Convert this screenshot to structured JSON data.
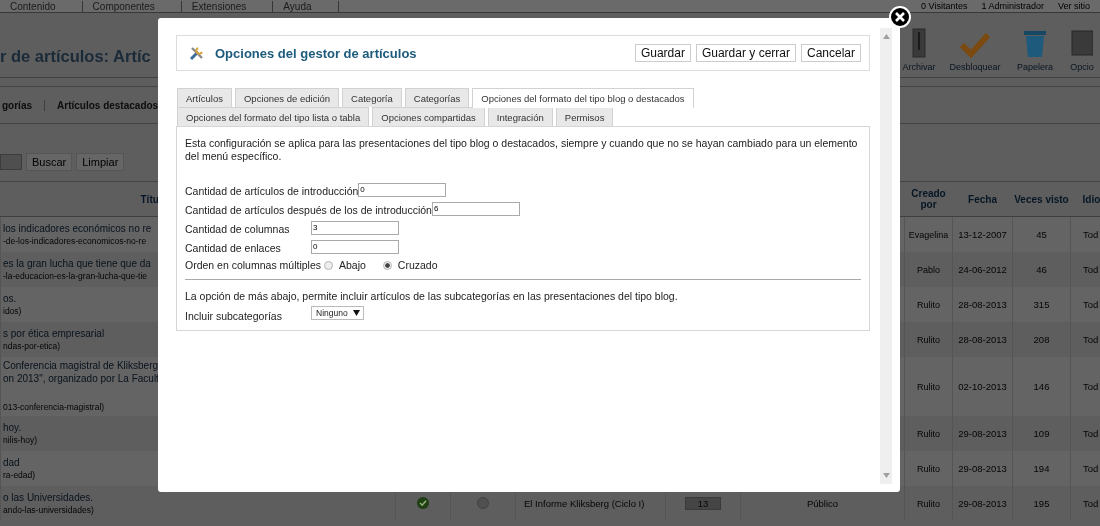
{
  "top_menu": {
    "items": [
      "Contenido",
      "Componentes",
      "Extensiones",
      "Ayuda"
    ],
    "right": [
      "0 Visitantes",
      "1 Administrador",
      "Ver sitio"
    ]
  },
  "page_title": "r de artículos: Artíc",
  "toolbar": [
    {
      "label": "Archivar",
      "kind": "archive"
    },
    {
      "label": "Desbloquear",
      "kind": "check"
    },
    {
      "label": "Papelera",
      "kind": "trash"
    },
    {
      "label": "Opcio",
      "kind": "options"
    }
  ],
  "subnav": [
    "gorías",
    "Artículos destacados"
  ],
  "filter_buttons": [
    "Buscar",
    "Limpiar"
  ],
  "table": {
    "columns": {
      "title": "Títu",
      "author": "Creado por",
      "date": "Fecha",
      "hits": "Veces visto",
      "language": "Idio"
    },
    "rows": [
      {
        "title": [
          "los indicadores económicos no re"
        ],
        "alias": "-de-los-indicadores-economicos-no-re",
        "author": "Evagelina",
        "date": "13-12-2007",
        "hits": "45",
        "language": "Tod"
      },
      {
        "title": [
          "es la gran lucha que tiene que da"
        ],
        "alias": "-la-educacion-es-la-gran-lucha-que-tie",
        "author": "Pablo",
        "date": "24-06-2012",
        "hits": "46",
        "language": "Tod"
      },
      {
        "title": [
          "os."
        ],
        "alias": "idos)",
        "author": "Rulito",
        "date": "28-08-2013",
        "hits": "315",
        "language": "Tod"
      },
      {
        "title": [
          "s por ética empresarial"
        ],
        "alias": "ndas-por-etica)",
        "author": "Rulito",
        "date": "28-08-2013",
        "hits": "208",
        "language": "Tod"
      },
      {
        "title": [
          "Conferencia magistral de Kliksberg",
          "on 2013\", organizado por La Facult"
        ],
        "alias": "013-conferencia-magistral)",
        "author": "Rulito",
        "date": "02-10-2013",
        "hits": "146",
        "language": "Tod"
      },
      {
        "title": [
          "hoy."
        ],
        "alias": "nilis-hoy)",
        "author": "Rulito",
        "date": "29-08-2013",
        "hits": "109",
        "language": "Tod"
      },
      {
        "title": [
          "dad"
        ],
        "alias": "ra-edad)",
        "author": "Rulito",
        "date": "29-08-2013",
        "hits": "194",
        "language": "Tod"
      },
      {
        "title": [
          "o las Universidades."
        ],
        "alias": "ando-las-universidades)",
        "published": true,
        "featured": false,
        "category": "El Informe Kliksberg (Ciclo I)",
        "ordering": "13",
        "access": "Público",
        "author": "Rulito",
        "date": "29-08-2013",
        "hits": "195",
        "language": "Tod"
      }
    ]
  },
  "modal": {
    "title": "Opciones del gestor de artículos",
    "buttons": [
      "Guardar",
      "Guardar y cerrar",
      "Cancelar"
    ],
    "tabs": [
      {
        "label": "Artículos",
        "selected": false
      },
      {
        "label": "Opciones de edición",
        "selected": false
      },
      {
        "label": "Categoría",
        "selected": false
      },
      {
        "label": "Categorías",
        "selected": false
      },
      {
        "label": "Opciones del formato del tipo blog o destacados",
        "selected": true
      },
      {
        "label": "Opciones del formato del tipo lista o tabla",
        "selected": false
      },
      {
        "label": "Opciones compartidas",
        "selected": false
      },
      {
        "label": "Integración",
        "selected": false
      },
      {
        "label": "Permisos",
        "selected": false
      }
    ],
    "description": "Esta configuración se aplica para las presentaciones del tipo blog o destacados, siempre y cuando que no se hayan cambiado para un elemento del menú específico.",
    "fields": [
      {
        "kind": "text",
        "label": "Cantidad de artículos de introducción",
        "value": "0"
      },
      {
        "kind": "text",
        "label": "Cantidad de artículos después de los de introducción",
        "value": "6"
      },
      {
        "kind": "text",
        "label": "Cantidad de columnas",
        "value": "3"
      },
      {
        "kind": "text",
        "label": "Cantidad de enlaces",
        "value": "0"
      },
      {
        "kind": "radio",
        "label": "Orden en columnas múltiples",
        "options": [
          {
            "label": "Abajo",
            "selected": false
          },
          {
            "label": "Cruzado",
            "selected": true
          }
        ]
      }
    ],
    "note": "La opción de más abajo, permite incluir artículos de las subcategorías en las presentaciones del tipo blog.",
    "select": {
      "label": "Incluir subcategorías",
      "value": "Ninguno"
    }
  }
}
